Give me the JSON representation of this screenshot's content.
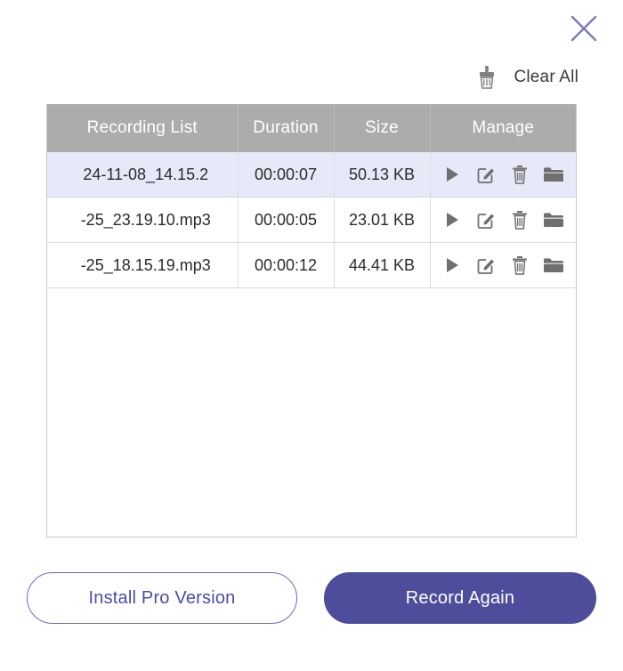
{
  "window": {
    "close_icon": "close-icon",
    "accent_color": "#4d4d9c",
    "outline_color": "#6a6ac0",
    "header_color": "#acacac",
    "selected_row_color": "#e8e9f8"
  },
  "toolbar": {
    "clear_all_label": "Clear All",
    "clear_all_icon": "broom-icon"
  },
  "table": {
    "columns": [
      {
        "key": "name",
        "label": "Recording List"
      },
      {
        "key": "duration",
        "label": "Duration"
      },
      {
        "key": "size",
        "label": "Size"
      },
      {
        "key": "manage",
        "label": "Manage"
      }
    ],
    "manage_actions": [
      {
        "name": "play-icon",
        "label": "Play"
      },
      {
        "name": "edit-icon",
        "label": "Edit"
      },
      {
        "name": "trash-icon",
        "label": "Delete"
      },
      {
        "name": "folder-icon",
        "label": "Open Folder"
      }
    ],
    "rows": [
      {
        "name": "24-11-08_14.15.2",
        "duration": "00:00:07",
        "size": "50.13 KB",
        "selected": true
      },
      {
        "name": "-25_23.19.10.mp3",
        "duration": "00:00:05",
        "size": "23.01 KB",
        "selected": false
      },
      {
        "name": "-25_18.15.19.mp3",
        "duration": "00:00:12",
        "size": "44.41 KB",
        "selected": false
      }
    ]
  },
  "footer": {
    "install_pro_label": "Install Pro Version",
    "record_again_label": "Record Again"
  }
}
